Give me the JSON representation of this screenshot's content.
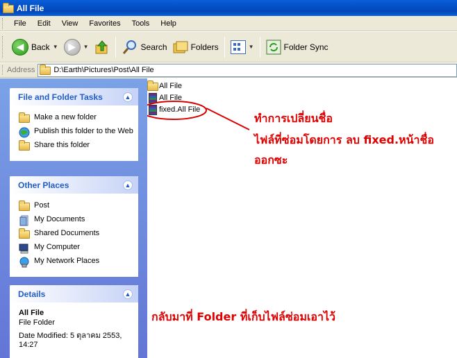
{
  "window": {
    "title": "All File"
  },
  "menu": [
    "File",
    "Edit",
    "View",
    "Favorites",
    "Tools",
    "Help"
  ],
  "toolbar": {
    "back_label": "Back",
    "search_label": "Search",
    "folders_label": "Folders",
    "folder_sync_label": "Folder Sync"
  },
  "address": {
    "label": "Address",
    "path": "D:\\Earth\\Pictures\\Post\\All File"
  },
  "panels": {
    "tasks": {
      "title": "File and Folder Tasks",
      "items": [
        "Make a new folder",
        "Publish this folder to the Web",
        "Share this folder"
      ]
    },
    "places": {
      "title": "Other Places",
      "items": [
        "Post",
        "My Documents",
        "Shared Documents",
        "My Computer",
        "My Network Places"
      ]
    },
    "details": {
      "title": "Details",
      "name": "All File",
      "type": "File Folder",
      "modified": "Date Modified: 5 ตุลาคม 2553, 14:27"
    }
  },
  "files": [
    {
      "name": "All File",
      "icon": "folder-icon"
    },
    {
      "name": "All File",
      "icon": "archive-icon"
    },
    {
      "name": "fixed.All File",
      "icon": "archive-icon"
    }
  ],
  "annotations": {
    "rename_1": "ทำการเปลี่ยนชื่อ",
    "rename_2": "ไฟล์ที่ซ่อมโดยการ ลบ fixed.หน้าชื่อ",
    "rename_3": "ออกซะ",
    "back_note": "กลับมาที่ Folder ที่เก็บไฟล์ซ่อมเอาไว้"
  },
  "colors": {
    "annotation": "#e00000",
    "pane_blue": "#6375d6",
    "panel_title": "#215dc6"
  }
}
